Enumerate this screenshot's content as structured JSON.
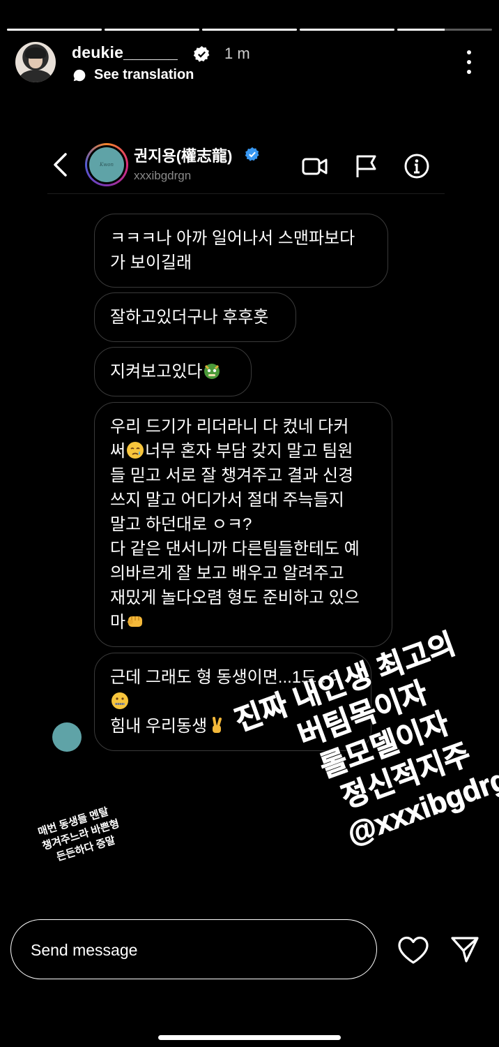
{
  "story": {
    "progress": [
      1,
      1,
      1,
      1,
      0.5
    ],
    "username": "deukie______",
    "time": "1 m",
    "translate_label": "See translation",
    "avatar_icon": "user-avatar",
    "menu_icon": "more-vertical-icon"
  },
  "dm": {
    "name": "권지용(權志龍)",
    "handle": "xxxibgdrgn",
    "icons": {
      "back": "chevron-left-icon",
      "video": "video-call-icon",
      "report": "flag-icon",
      "info": "info-icon"
    }
  },
  "messages": [
    {
      "lines": [
        "ㅋㅋㅋ나 아까 일어나서 스맨파보다",
        "가 보이길래"
      ]
    },
    {
      "lines": [
        "잘하고있더구나 후후훗"
      ]
    },
    {
      "lines": [
        "지켜보고있다"
      ],
      "emoji": "dragon-emoji"
    },
    {
      "lines": [
        "우리 드기가 리더라니 다 컸네 다커",
        "써",
        "너무 혼자 부담 갖지 말고 팀원",
        "들 믿고 서로 잘 챙겨주고 결과 신경",
        "쓰지 말고 어디가서 절대 주늑들지",
        "말고 하던대로 ㅇㅋ?",
        "다 같은 댄서니까 다른팀들한테도 예",
        "의바르게 잘 보고 배우고 알려주고",
        "재밌게 놀다오렴 형도 준비하고 있으",
        "마"
      ],
      "emoji": [
        "crying-face-emoji",
        "fist-emoji"
      ]
    },
    {
      "lines": [
        "근데 그래도 형 동생이면...1드..ㅇ",
        "",
        "힘내 우리동생"
      ],
      "emoji": [
        "zipper-mouth-emoji",
        "crossed-fingers-emoji"
      ]
    }
  ],
  "overlay_big": [
    "진짜 내인생 최고의",
    "버팀목이자",
    "롤모델이자",
    "정신적지주",
    "@xxxibgdrgn"
  ],
  "overlay_small": [
    "매번 동생들 멘탈",
    "챙겨주느라 바쁜형",
    "든든하다 증말"
  ],
  "reply": {
    "placeholder": "Send message",
    "like_icon": "heart-icon",
    "send_icon": "send-icon"
  },
  "colors": {
    "background": "#000000",
    "bubble_border": "#3a3a3a",
    "verified": "#3897f0",
    "avatar_teal": "#5fa3a7"
  }
}
